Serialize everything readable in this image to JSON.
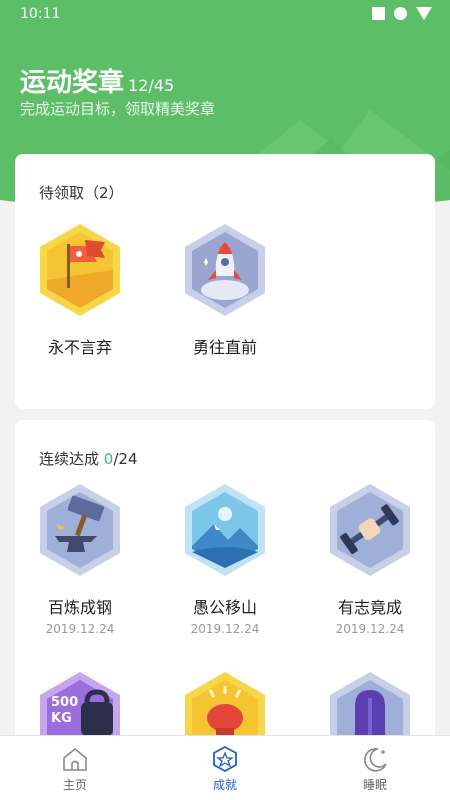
{
  "status_bar": {
    "time": "10:11"
  },
  "header": {
    "title": "运动奖章",
    "count": "12/45",
    "subtitle": "完成运动目标，领取精美奖章"
  },
  "pending": {
    "title": "待领取（2）",
    "badges": [
      {
        "name": "永不言弃",
        "icon": "flag-icon"
      },
      {
        "name": "勇往直前",
        "icon": "rocket-icon"
      }
    ]
  },
  "streak": {
    "title": "连续达成",
    "achieved": "0",
    "total": "/24",
    "badges": [
      {
        "name": "百炼成钢",
        "date": "2019.12.24",
        "icon": "anvil-icon"
      },
      {
        "name": "愚公移山",
        "date": "2019.12.24",
        "icon": "mountain-icon"
      },
      {
        "name": "有志竟成",
        "date": "2019.12.24",
        "icon": "dumbbell-icon"
      },
      {
        "name": "",
        "date": "",
        "icon": "kettlebell-icon",
        "icon_text": "500 KG"
      },
      {
        "name": "",
        "date": "",
        "icon": "boxing-glove-icon"
      },
      {
        "name": "",
        "date": "",
        "icon": "door-icon"
      }
    ]
  },
  "tabs": [
    {
      "label": "主页",
      "icon": "home-icon"
    },
    {
      "label": "成就",
      "icon": "achievement-icon",
      "active": true
    },
    {
      "label": "睡眠",
      "icon": "moon-icon"
    }
  ],
  "colors": {
    "brand_green": "#5cbf67",
    "accent_blue": "#1e5fc8",
    "count_green": "#3cb86a"
  }
}
